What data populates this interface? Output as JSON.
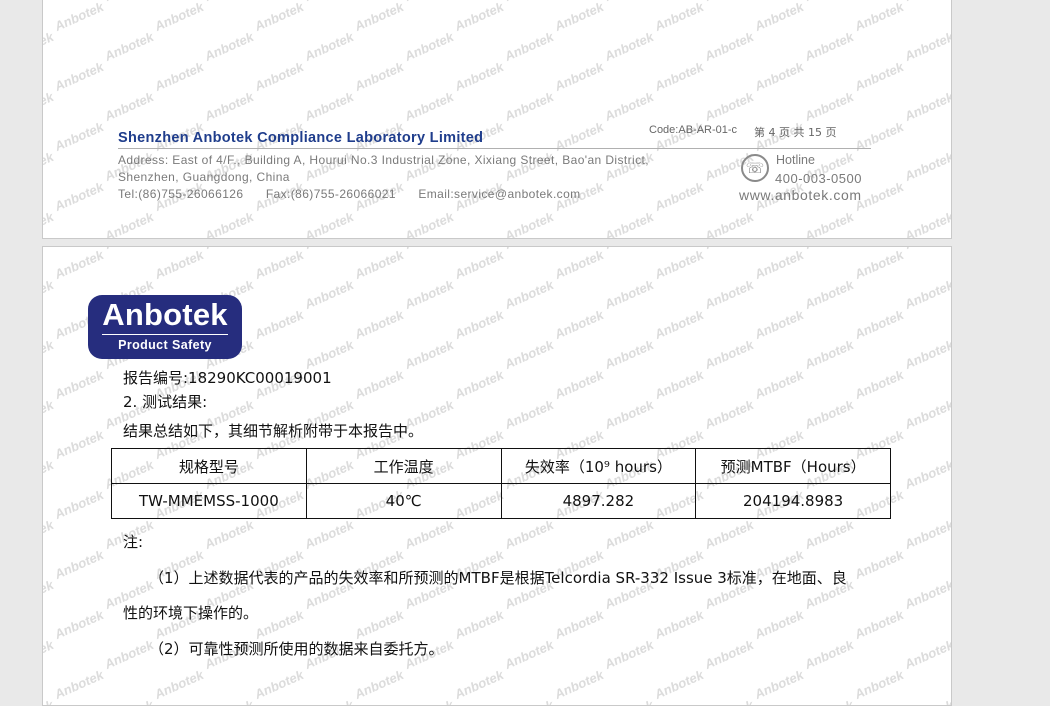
{
  "watermark_text": "Anbotek",
  "header": {
    "company": "Shenzhen Anbotek Compliance Laboratory Limited",
    "code": "Code:AB-AR-01-c",
    "page_info": "第 4 页 共 15 页",
    "address_line1": "Address: East of 4/F., Building A, Hourui No.3 Industrial Zone, Xixiang Street, Bao'an District,",
    "address_line2": "Shenzhen, Guangdong, China",
    "contact_line": "Tel:(86)755-26066126      Fax:(86)755-26066021      Email:service@anbotek.com",
    "hotline_label": "Hotline",
    "hotline_number": "400-003-0500",
    "website": "www.anbotek.com"
  },
  "logo": {
    "name": "Anbotek",
    "subtitle": "Product Safety"
  },
  "report": {
    "number_line": "报告编号:18290KC00019001",
    "section_title": "2. 测试结果:",
    "summary": "结果总结如下，其细节解析附带于本报告中。",
    "table": {
      "headers": [
        "规格型号",
        "工作温度",
        "失效率（10⁹ hours）",
        "预测MTBF（Hours）"
      ],
      "rows": [
        [
          "TW-MMEMSS-1000",
          "40℃",
          "4897.282",
          "204194.8983"
        ]
      ]
    },
    "note_label": "注:",
    "note1_line1": "（1）上述数据代表的产品的失效率和所预测的MTBF是根据Telcordia SR-332 Issue 3标准，在地面、良",
    "note1_line2": "性的环境下操作的。",
    "note2": "（2）可靠性预测所使用的数据来自委托方。"
  },
  "colors": {
    "brand_blue": "#262d7e",
    "company_blue": "#1f3d8c"
  }
}
